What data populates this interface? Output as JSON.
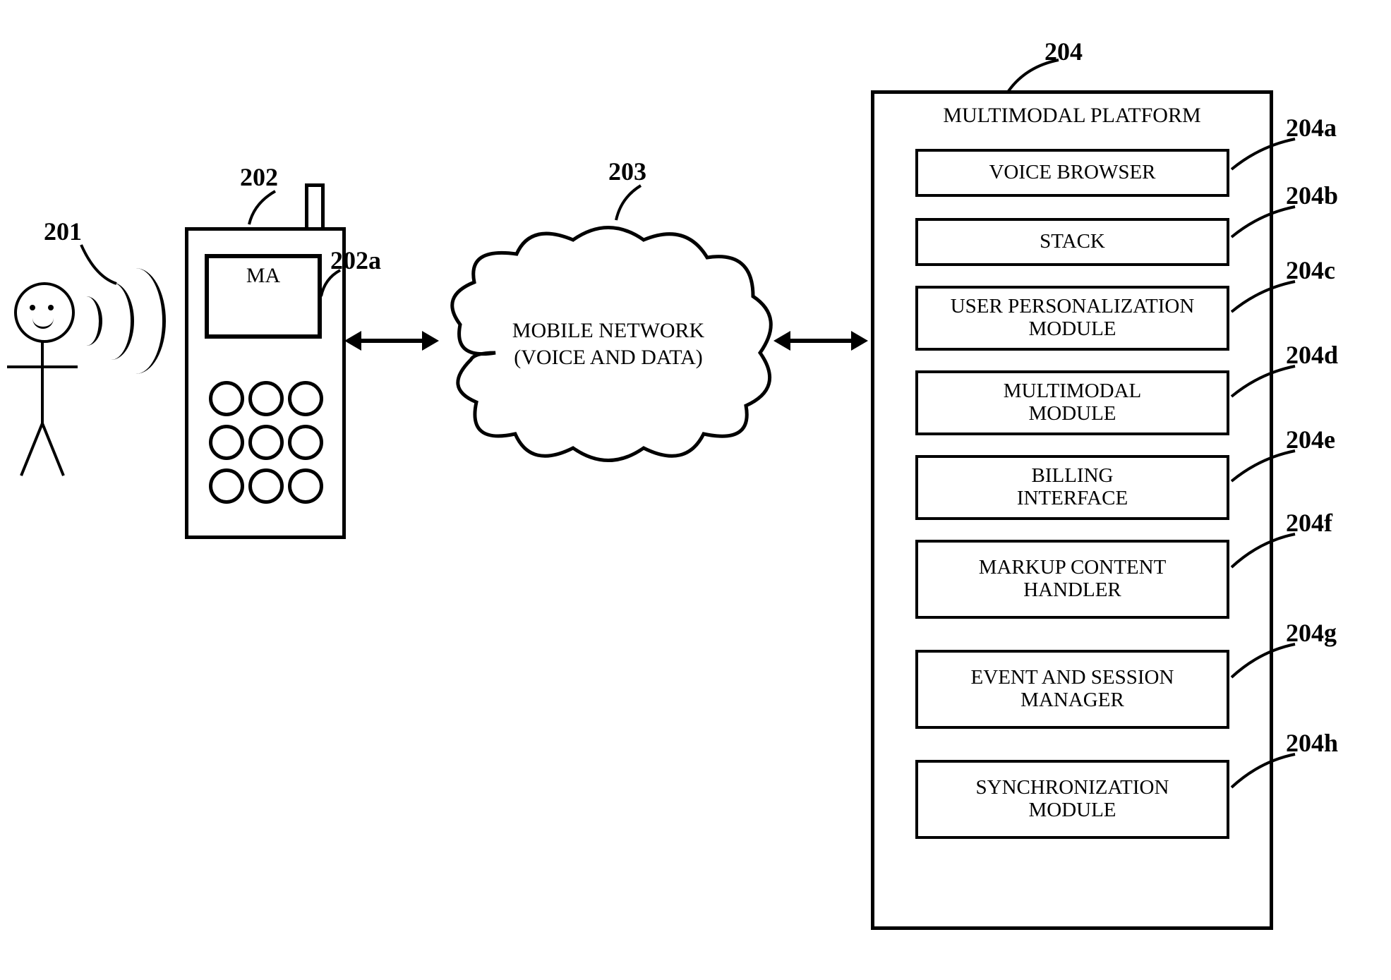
{
  "refs": {
    "user": "201",
    "phone": "202",
    "phone_screen": "202a",
    "cloud": "203",
    "platform": "204",
    "mod_a": "204a",
    "mod_b": "204b",
    "mod_c": "204c",
    "mod_d": "204d",
    "mod_e": "204e",
    "mod_f": "204f",
    "mod_g": "204g",
    "mod_h": "204h"
  },
  "phone": {
    "screen_text": "MA"
  },
  "cloud": {
    "label_line1": "MOBILE NETWORK",
    "label_line2": "(VOICE AND DATA)"
  },
  "platform": {
    "title": "MULTIMODAL PLATFORM",
    "modules": {
      "a": "VOICE BROWSER",
      "b": "STACK",
      "c": "USER PERSONALIZATION\nMODULE",
      "d": "MULTIMODAL\nMODULE",
      "e": "BILLING\nINTERFACE",
      "f": "MARKUP CONTENT\nHANDLER",
      "g": "EVENT AND SESSION\nMANAGER",
      "h": "SYNCHRONIZATION\nMODULE"
    }
  }
}
